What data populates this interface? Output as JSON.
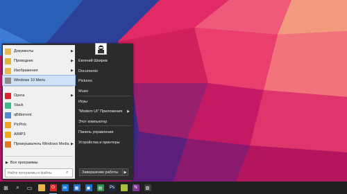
{
  "start_menu": {
    "programs": [
      {
        "label": "Документы",
        "icon": "documents-folder-icon",
        "color": "#e8b84a",
        "has_submenu": true
      },
      {
        "label": "Проводник",
        "icon": "file-explorer-icon",
        "color": "#e3b03c",
        "has_submenu": true
      },
      {
        "label": "Изображения",
        "icon": "pictures-folder-icon",
        "color": "#e8b84a",
        "has_submenu": true
      },
      {
        "label": "Windows 10 Menu",
        "icon": "windows10-menu-app-icon",
        "color": "#8a8a8a",
        "has_submenu": false
      },
      {
        "label": "Opera",
        "icon": "opera-icon",
        "color": "#e0242c",
        "has_submenu": true
      },
      {
        "label": "Slack",
        "icon": "slack-icon",
        "color": "#3fb98c",
        "has_submenu": false
      },
      {
        "label": "qBittorrent",
        "icon": "qbittorrent-icon",
        "color": "#4f8ad6",
        "has_submenu": false
      },
      {
        "label": "PicPick",
        "icon": "picpick-icon",
        "color": "#f0a21f",
        "has_submenu": false
      },
      {
        "label": "AIMP3",
        "icon": "aimp3-icon",
        "color": "#f3a81b",
        "has_submenu": false
      },
      {
        "label": "Проигрыватель Windows Media",
        "icon": "windows-media-player-icon",
        "color": "#e57a1c",
        "has_submenu": true
      }
    ],
    "all_programs_label": "Все программы",
    "search_placeholder": "Найти программы и файлы",
    "right_items": [
      {
        "label": "Евгений Шкирев",
        "has_submenu": false
      },
      {
        "label": "Documents",
        "has_submenu": false
      },
      {
        "label": "Pictures",
        "has_submenu": false
      },
      {
        "label": "Music",
        "has_submenu": false
      },
      {
        "label": "Игры",
        "has_submenu": false
      },
      {
        "label": "\"Modern UI\" Приложения",
        "has_submenu": true
      },
      {
        "label": "Этот компьютер",
        "has_submenu": false
      },
      {
        "label": "Панель управления",
        "has_submenu": false
      },
      {
        "label": "Устройства и принтеры",
        "has_submenu": false
      }
    ],
    "shutdown_label": "Завершение работы"
  },
  "taskbar": {
    "items": [
      {
        "name": "start-button",
        "icon": "windows-logo-icon",
        "color": "#ffffff",
        "active": false
      },
      {
        "name": "search-button",
        "icon": "search-icon",
        "color": "#ffffff",
        "active": false
      },
      {
        "name": "task-view-button",
        "icon": "task-view-icon",
        "color": "#ffffff",
        "active": false
      },
      {
        "name": "file-explorer-button",
        "icon": "folder-icon",
        "color": "#e8b84a",
        "active": false
      },
      {
        "name": "opera-button",
        "icon": "opera-icon",
        "color": "#e0242c",
        "active": true
      },
      {
        "name": "mail-button",
        "icon": "mail-icon",
        "color": "#1f77d0",
        "active": false
      },
      {
        "name": "calendar-button",
        "icon": "calendar-icon",
        "color": "#2a6fc4",
        "active": false
      },
      {
        "name": "store-button",
        "icon": "store-icon",
        "color": "#1e6fc2",
        "active": false
      },
      {
        "name": "sheets-button",
        "icon": "spreadsheet-icon",
        "color": "#2f8f4e",
        "active": false
      },
      {
        "name": "photoshop-button",
        "icon": "photoshop-icon",
        "color": "#1c2c3c",
        "active": false
      },
      {
        "name": "app-button",
        "icon": "app-icon",
        "color": "#a6c23d",
        "active": false
      },
      {
        "name": "onenote-button",
        "icon": "onenote-icon",
        "color": "#7a3796",
        "active": false
      },
      {
        "name": "viewer-button",
        "icon": "viewer-icon",
        "color": "#3b3b3b",
        "active": false
      }
    ]
  }
}
